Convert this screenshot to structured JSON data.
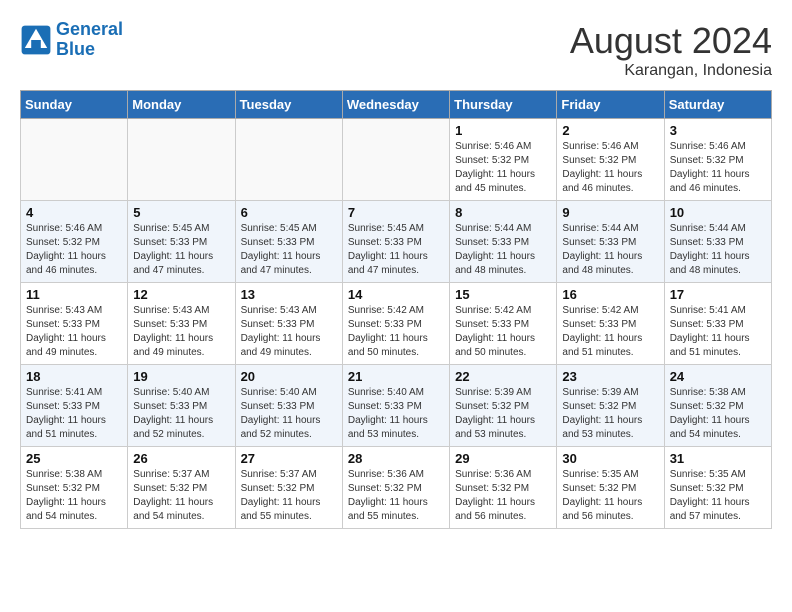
{
  "header": {
    "logo_line1": "General",
    "logo_line2": "Blue",
    "month_year": "August 2024",
    "location": "Karangan, Indonesia"
  },
  "days_of_week": [
    "Sunday",
    "Monday",
    "Tuesday",
    "Wednesday",
    "Thursday",
    "Friday",
    "Saturday"
  ],
  "weeks": [
    [
      {
        "day": "",
        "info": ""
      },
      {
        "day": "",
        "info": ""
      },
      {
        "day": "",
        "info": ""
      },
      {
        "day": "",
        "info": ""
      },
      {
        "day": "1",
        "info": "Sunrise: 5:46 AM\nSunset: 5:32 PM\nDaylight: 11 hours\nand 45 minutes."
      },
      {
        "day": "2",
        "info": "Sunrise: 5:46 AM\nSunset: 5:32 PM\nDaylight: 11 hours\nand 46 minutes."
      },
      {
        "day": "3",
        "info": "Sunrise: 5:46 AM\nSunset: 5:32 PM\nDaylight: 11 hours\nand 46 minutes."
      }
    ],
    [
      {
        "day": "4",
        "info": "Sunrise: 5:46 AM\nSunset: 5:32 PM\nDaylight: 11 hours\nand 46 minutes."
      },
      {
        "day": "5",
        "info": "Sunrise: 5:45 AM\nSunset: 5:33 PM\nDaylight: 11 hours\nand 47 minutes."
      },
      {
        "day": "6",
        "info": "Sunrise: 5:45 AM\nSunset: 5:33 PM\nDaylight: 11 hours\nand 47 minutes."
      },
      {
        "day": "7",
        "info": "Sunrise: 5:45 AM\nSunset: 5:33 PM\nDaylight: 11 hours\nand 47 minutes."
      },
      {
        "day": "8",
        "info": "Sunrise: 5:44 AM\nSunset: 5:33 PM\nDaylight: 11 hours\nand 48 minutes."
      },
      {
        "day": "9",
        "info": "Sunrise: 5:44 AM\nSunset: 5:33 PM\nDaylight: 11 hours\nand 48 minutes."
      },
      {
        "day": "10",
        "info": "Sunrise: 5:44 AM\nSunset: 5:33 PM\nDaylight: 11 hours\nand 48 minutes."
      }
    ],
    [
      {
        "day": "11",
        "info": "Sunrise: 5:43 AM\nSunset: 5:33 PM\nDaylight: 11 hours\nand 49 minutes."
      },
      {
        "day": "12",
        "info": "Sunrise: 5:43 AM\nSunset: 5:33 PM\nDaylight: 11 hours\nand 49 minutes."
      },
      {
        "day": "13",
        "info": "Sunrise: 5:43 AM\nSunset: 5:33 PM\nDaylight: 11 hours\nand 49 minutes."
      },
      {
        "day": "14",
        "info": "Sunrise: 5:42 AM\nSunset: 5:33 PM\nDaylight: 11 hours\nand 50 minutes."
      },
      {
        "day": "15",
        "info": "Sunrise: 5:42 AM\nSunset: 5:33 PM\nDaylight: 11 hours\nand 50 minutes."
      },
      {
        "day": "16",
        "info": "Sunrise: 5:42 AM\nSunset: 5:33 PM\nDaylight: 11 hours\nand 51 minutes."
      },
      {
        "day": "17",
        "info": "Sunrise: 5:41 AM\nSunset: 5:33 PM\nDaylight: 11 hours\nand 51 minutes."
      }
    ],
    [
      {
        "day": "18",
        "info": "Sunrise: 5:41 AM\nSunset: 5:33 PM\nDaylight: 11 hours\nand 51 minutes."
      },
      {
        "day": "19",
        "info": "Sunrise: 5:40 AM\nSunset: 5:33 PM\nDaylight: 11 hours\nand 52 minutes."
      },
      {
        "day": "20",
        "info": "Sunrise: 5:40 AM\nSunset: 5:33 PM\nDaylight: 11 hours\nand 52 minutes."
      },
      {
        "day": "21",
        "info": "Sunrise: 5:40 AM\nSunset: 5:33 PM\nDaylight: 11 hours\nand 53 minutes."
      },
      {
        "day": "22",
        "info": "Sunrise: 5:39 AM\nSunset: 5:32 PM\nDaylight: 11 hours\nand 53 minutes."
      },
      {
        "day": "23",
        "info": "Sunrise: 5:39 AM\nSunset: 5:32 PM\nDaylight: 11 hours\nand 53 minutes."
      },
      {
        "day": "24",
        "info": "Sunrise: 5:38 AM\nSunset: 5:32 PM\nDaylight: 11 hours\nand 54 minutes."
      }
    ],
    [
      {
        "day": "25",
        "info": "Sunrise: 5:38 AM\nSunset: 5:32 PM\nDaylight: 11 hours\nand 54 minutes."
      },
      {
        "day": "26",
        "info": "Sunrise: 5:37 AM\nSunset: 5:32 PM\nDaylight: 11 hours\nand 54 minutes."
      },
      {
        "day": "27",
        "info": "Sunrise: 5:37 AM\nSunset: 5:32 PM\nDaylight: 11 hours\nand 55 minutes."
      },
      {
        "day": "28",
        "info": "Sunrise: 5:36 AM\nSunset: 5:32 PM\nDaylight: 11 hours\nand 55 minutes."
      },
      {
        "day": "29",
        "info": "Sunrise: 5:36 AM\nSunset: 5:32 PM\nDaylight: 11 hours\nand 56 minutes."
      },
      {
        "day": "30",
        "info": "Sunrise: 5:35 AM\nSunset: 5:32 PM\nDaylight: 11 hours\nand 56 minutes."
      },
      {
        "day": "31",
        "info": "Sunrise: 5:35 AM\nSunset: 5:32 PM\nDaylight: 11 hours\nand 57 minutes."
      }
    ]
  ]
}
